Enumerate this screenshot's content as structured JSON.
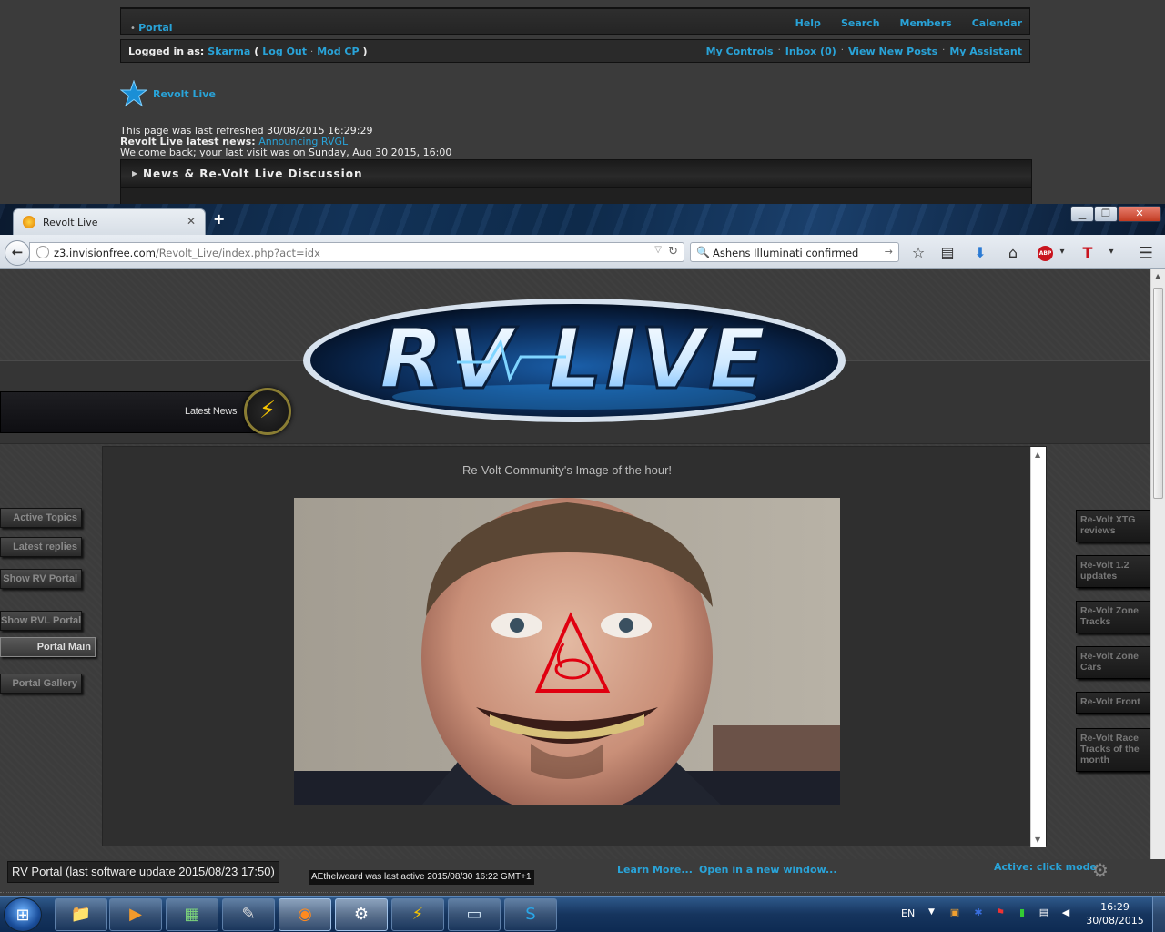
{
  "forum": {
    "nav_left": "Portal",
    "nav_right": [
      "Help",
      "Search",
      "Members",
      "Calendar"
    ],
    "logged_in_label": "Logged in as:",
    "username": "Skarma",
    "paren_open": "(",
    "paren_close": ")",
    "logout": "Log Out",
    "modcp": "Mod CP",
    "user_links": [
      "My Controls",
      "Inbox (0)",
      "View New Posts",
      "My Assistant"
    ],
    "site_name": "Revolt Live",
    "refreshed": "This page was last refreshed 30/08/2015 16:29:29",
    "news_label": "Revolt Live latest news:",
    "news_link": "Announcing RVGL",
    "welcome": "Welcome back; your last visit was on Sunday, Aug 30 2015, 16:00",
    "category_title": "News & Re-Volt Live Discussion"
  },
  "browser": {
    "tab_title": "Revolt Live",
    "tab_close": "✕",
    "new_tab": "+",
    "url_domain": "z3.invisionfree.com",
    "url_path": "/Revolt_Live/index.php?act=idx",
    "search_query": "Ashens Illuminati confirmed",
    "abp": "ABP"
  },
  "page": {
    "logo_text": "RV LIVE",
    "latest_news": "Latest News",
    "image_caption": "Re-Volt Community's Image of the hour!",
    "left_buttons": [
      {
        "label": "Active Topics"
      },
      {
        "label": "Latest replies"
      },
      {
        "label": "Show RV Portal"
      },
      {
        "label": "Show RVL Portal"
      },
      {
        "label": "Portal Main"
      },
      {
        "label": "Portal Gallery"
      }
    ],
    "right_buttons": [
      {
        "label": "Re-Volt XTG reviews"
      },
      {
        "label": "Re-Volt 1.2 updates"
      },
      {
        "label": "Re-Volt Zone Tracks"
      },
      {
        "label": "Re-Volt Zone Cars"
      },
      {
        "label": "Re-Volt Front"
      },
      {
        "label": "Re-Volt Race Tracks of the month"
      }
    ],
    "status_text": "RV Portal (last software update 2015/08/23 17:50)",
    "tooltip": "AEthelweard was last active 2015/08/30 16:22 GMT+1",
    "learn_more": "Learn More...",
    "open_new_window": "Open in a new window...",
    "active_mode": "Active: click mode"
  },
  "taskbar": {
    "lang": "EN",
    "time": "16:29",
    "date": "30/08/2015"
  }
}
